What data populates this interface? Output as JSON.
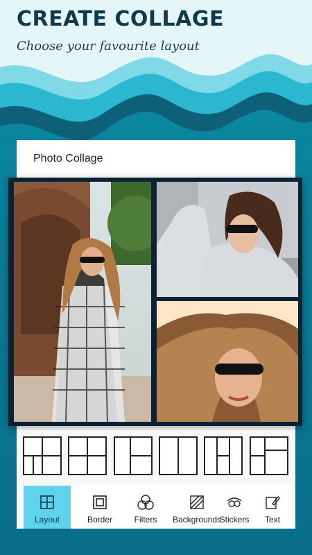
{
  "hero": {
    "title": "CREATE COLLAGE",
    "subtitle": "Choose your favourite layout"
  },
  "app": {
    "title": "Photo Collage"
  },
  "collage": {
    "photos": [
      {
        "name": "woman-standing-plaid-coat"
      },
      {
        "name": "woman-sunglasses-grey-hoodie"
      },
      {
        "name": "woman-sunglasses-windblown-hair"
      }
    ]
  },
  "layout_options": [
    {
      "name": "layout-1"
    },
    {
      "name": "layout-2"
    },
    {
      "name": "layout-3"
    },
    {
      "name": "layout-4"
    },
    {
      "name": "layout-5"
    },
    {
      "name": "layout-6"
    }
  ],
  "toolbar": {
    "items": [
      {
        "label": "Layout",
        "icon": "layout-icon",
        "active": true
      },
      {
        "label": "Border",
        "icon": "border-icon",
        "active": false
      },
      {
        "label": "Filters",
        "icon": "filters-icon",
        "active": false
      },
      {
        "label": "Backgrounds",
        "icon": "backgrounds-icon",
        "active": false
      },
      {
        "label": "Stickers",
        "icon": "stickers-icon",
        "active": false
      },
      {
        "label": "Text",
        "icon": "text-icon",
        "active": false
      }
    ]
  },
  "colors": {
    "accent": "#5fd2ec",
    "title": "#0f3a4c",
    "background": "#0a7c96"
  }
}
